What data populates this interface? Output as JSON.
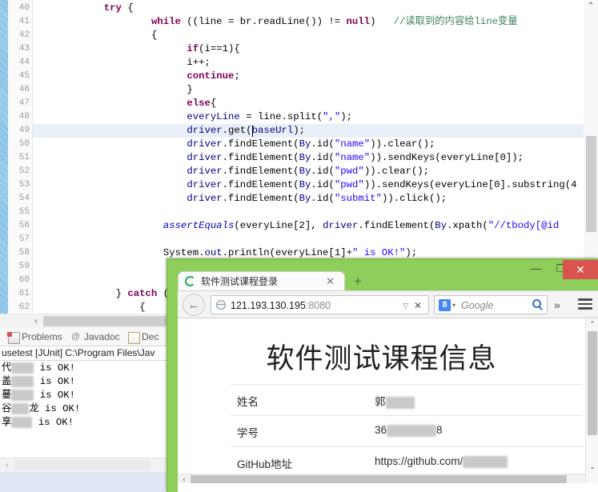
{
  "ide": {
    "editor": {
      "first_line_number": 40,
      "last_line_number": 62,
      "highlighted_line": 49,
      "lines": [
        {
          "n": 40,
          "indent": 12,
          "tokens": [
            {
              "t": "try",
              "c": "kw"
            },
            {
              "t": " {",
              "c": "norm"
            }
          ]
        },
        {
          "n": 41,
          "indent": 20,
          "tokens": [
            {
              "t": "while",
              "c": "kw"
            },
            {
              "t": " ((line = br.readLine()) ",
              "c": "norm"
            },
            {
              "t": "!=",
              "c": "norm"
            },
            {
              "t": " ",
              "c": "norm"
            },
            {
              "t": "null",
              "c": "kw"
            },
            {
              "t": ")   ",
              "c": "norm"
            },
            {
              "t": "//读取到的内容给line变量",
              "c": "cm"
            }
          ]
        },
        {
          "n": 42,
          "indent": 20,
          "tokens": [
            {
              "t": "{",
              "c": "norm"
            }
          ]
        },
        {
          "n": 43,
          "indent": 26,
          "tokens": [
            {
              "t": "if",
              "c": "kw"
            },
            {
              "t": "(i==1){",
              "c": "norm"
            }
          ]
        },
        {
          "n": 44,
          "indent": 26,
          "tokens": [
            {
              "t": "i++;",
              "c": "norm"
            }
          ]
        },
        {
          "n": 45,
          "indent": 26,
          "tokens": [
            {
              "t": "continue",
              "c": "kw"
            },
            {
              "t": ";",
              "c": "norm"
            }
          ]
        },
        {
          "n": 46,
          "indent": 26,
          "tokens": [
            {
              "t": "}",
              "c": "norm"
            }
          ]
        },
        {
          "n": 47,
          "indent": 26,
          "tokens": [
            {
              "t": "else",
              "c": "kw"
            },
            {
              "t": "{",
              "c": "norm"
            }
          ]
        },
        {
          "n": 48,
          "indent": 26,
          "tokens": [
            {
              "t": "everyLine",
              "c": "blu"
            },
            {
              "t": " = line.split(",
              "c": "norm"
            },
            {
              "t": "\",\"",
              "c": "str"
            },
            {
              "t": ");",
              "c": "norm"
            }
          ]
        },
        {
          "n": 49,
          "indent": 26,
          "tokens": [
            {
              "t": "driver",
              "c": "blu"
            },
            {
              "t": ".get(",
              "c": "norm"
            },
            {
              "t": "baseUrl",
              "c": "blu"
            },
            {
              "t": ");",
              "c": "norm"
            }
          ]
        },
        {
          "n": 50,
          "indent": 26,
          "tokens": [
            {
              "t": "driver",
              "c": "blu"
            },
            {
              "t": ".findElement(",
              "c": "norm"
            },
            {
              "t": "By",
              "c": "blu"
            },
            {
              "t": ".id(",
              "c": "norm"
            },
            {
              "t": "\"name\"",
              "c": "str"
            },
            {
              "t": ")).clear();",
              "c": "norm"
            }
          ]
        },
        {
          "n": 51,
          "indent": 26,
          "tokens": [
            {
              "t": "driver",
              "c": "blu"
            },
            {
              "t": ".findElement(",
              "c": "norm"
            },
            {
              "t": "By",
              "c": "blu"
            },
            {
              "t": ".id(",
              "c": "norm"
            },
            {
              "t": "\"name\"",
              "c": "str"
            },
            {
              "t": ")).sendKeys(everyLine[0]);",
              "c": "norm"
            }
          ]
        },
        {
          "n": 52,
          "indent": 26,
          "tokens": [
            {
              "t": "driver",
              "c": "blu"
            },
            {
              "t": ".findElement(",
              "c": "norm"
            },
            {
              "t": "By",
              "c": "blu"
            },
            {
              "t": ".id(",
              "c": "norm"
            },
            {
              "t": "\"pwd\"",
              "c": "str"
            },
            {
              "t": ")).clear();",
              "c": "norm"
            }
          ]
        },
        {
          "n": 53,
          "indent": 26,
          "tokens": [
            {
              "t": "driver",
              "c": "blu"
            },
            {
              "t": ".findElement(",
              "c": "norm"
            },
            {
              "t": "By",
              "c": "blu"
            },
            {
              "t": ".id(",
              "c": "norm"
            },
            {
              "t": "\"pwd\"",
              "c": "str"
            },
            {
              "t": ")).sendKeys(everyLine[0].substring(4",
              "c": "norm"
            }
          ]
        },
        {
          "n": 54,
          "indent": 26,
          "tokens": [
            {
              "t": "driver",
              "c": "blu"
            },
            {
              "t": ".findElement(",
              "c": "norm"
            },
            {
              "t": "By",
              "c": "blu"
            },
            {
              "t": ".id(",
              "c": "norm"
            },
            {
              "t": "\"submit\"",
              "c": "str"
            },
            {
              "t": ")).click();",
              "c": "norm"
            }
          ]
        },
        {
          "n": 55,
          "indent": 0,
          "tokens": []
        },
        {
          "n": 56,
          "indent": 22,
          "tokens": [
            {
              "t": "assertEquals",
              "c": "stat"
            },
            {
              "t": "(everyLine[2], ",
              "c": "norm"
            },
            {
              "t": "driver",
              "c": "blu"
            },
            {
              "t": ".findElement(",
              "c": "norm"
            },
            {
              "t": "By",
              "c": "blu"
            },
            {
              "t": ".xpath(",
              "c": "norm"
            },
            {
              "t": "\"//tbody[@id",
              "c": "str"
            }
          ]
        },
        {
          "n": 57,
          "indent": 0,
          "tokens": []
        },
        {
          "n": 58,
          "indent": 22,
          "tokens": [
            {
              "t": "System",
              "c": "norm"
            },
            {
              "t": ".",
              "c": "norm"
            },
            {
              "t": "out",
              "c": "blu"
            },
            {
              "t": ".println(everyLine[1]+",
              "c": "norm"
            },
            {
              "t": "\" is OK!\"",
              "c": "str"
            },
            {
              "t": ");",
              "c": "norm"
            }
          ]
        },
        {
          "n": 59,
          "indent": 0,
          "tokens": []
        },
        {
          "n": 60,
          "indent": 26,
          "tokens": [
            {
              "t": "}",
              "c": "norm"
            }
          ]
        },
        {
          "n": 61,
          "indent": 14,
          "tokens": [
            {
              "t": "}",
              "c": "norm"
            },
            {
              "t": " ",
              "c": "norm"
            },
            {
              "t": "catch",
              "c": "kw"
            },
            {
              "t": " (IOE",
              "c": "norm"
            }
          ]
        },
        {
          "n": 62,
          "indent": 18,
          "tokens": [
            {
              "t": "{",
              "c": "norm"
            }
          ]
        }
      ]
    },
    "view_tabs": [
      {
        "label": "Problems",
        "icon": "problems-icon"
      },
      {
        "label": "Javadoc",
        "icon": "javadoc-icon"
      },
      {
        "label": "Dec",
        "icon": "declaration-icon"
      }
    ],
    "console": {
      "header": "usetest [JUnit] C:\\Program Files\\Jav",
      "lines": [
        {
          "prefix": "代",
          "redact_w": 28,
          "suffix": " is OK!"
        },
        {
          "prefix": "盖",
          "redact_w": 28,
          "suffix": " is OK!"
        },
        {
          "prefix": "蔓",
          "redact_w": 28,
          "suffix": " is OK!"
        },
        {
          "prefix": "谷",
          "redact_w": 22,
          "suffix": "龙 is OK!"
        },
        {
          "prefix": "享",
          "redact_w": 26,
          "suffix": " is OK!"
        }
      ]
    },
    "scrollbars": {
      "editor_h_arrow": "‹",
      "console_h_arrow": "‹",
      "arrow_up": "⌃",
      "arrow_down": "⌄"
    }
  },
  "browser": {
    "window_controls": {
      "minimize": "—",
      "maximize": "❐",
      "close": "✕"
    },
    "tab": {
      "title": "软件测试课程登录",
      "close": "✕"
    },
    "new_tab": "+",
    "nav": {
      "back": "←",
      "url_host": "121.193.130.195",
      "url_port": ":8080",
      "url_dropdown": "▽",
      "url_stop": "✕",
      "search_engine_badge": "8",
      "search_caret": "▾",
      "search_placeholder": "Google",
      "overflow": "»"
    },
    "page": {
      "title": "软件测试课程信息",
      "rows": [
        {
          "label": "姓名",
          "value_prefix": "郭",
          "redact_w": 36,
          "value_suffix": ""
        },
        {
          "label": "学号",
          "value_prefix": "36",
          "redact_w": 62,
          "value_suffix": "8"
        },
        {
          "label": "GitHub地址",
          "value_prefix": "https://github.com/",
          "redact_w": 56,
          "value_suffix": ""
        }
      ]
    }
  },
  "colors": {
    "window_frame_green": "#8ece5a",
    "close_red": "#d9534f",
    "highlight_blue": "#e8eff9",
    "keyword_purple": "#7f0055",
    "string_blue": "#2a00ff",
    "comment_green": "#3f7f5f",
    "field_blue": "#0000c0"
  }
}
